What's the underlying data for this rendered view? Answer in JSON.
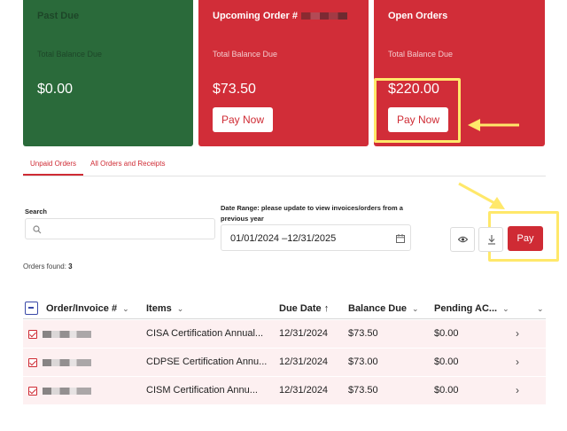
{
  "cards": {
    "past_due": {
      "title": "Past Due",
      "subtitle": "Total Balance Due",
      "amount": "$0.00"
    },
    "upcoming": {
      "title": "Upcoming Order #",
      "subtitle": "Total Balance Due",
      "amount": "$73.50",
      "button": "Pay Now"
    },
    "open": {
      "title": "Open Orders",
      "subtitle": "Total Balance Due",
      "amount": "$220.00",
      "button": "Pay Now"
    }
  },
  "tabs": {
    "unpaid": "Unpaid Orders",
    "all": "All Orders and Receipts"
  },
  "filters": {
    "search_label": "Search",
    "search_value": "",
    "date_label": "Date Range: please update to view invoices/orders from a previous year",
    "date_value": "01/01/2024 –12/31/2025",
    "pay_button": "Pay"
  },
  "orders_found": {
    "label": "Orders found:",
    "count": "3"
  },
  "table": {
    "headers": {
      "order": "Order/Invoice #",
      "items": "Items",
      "due_date": "Due Date ↑",
      "balance": "Balance Due",
      "pending": "Pending AC..."
    },
    "rows": [
      {
        "items": "CISA Certification Annual...",
        "due_date": "12/31/2024",
        "balance": "$73.50",
        "pending": "$0.00"
      },
      {
        "items": "CDPSE Certification Annu...",
        "due_date": "12/31/2024",
        "balance": "$73.00",
        "pending": "$0.00"
      },
      {
        "items": "CISM Certification Annu...",
        "due_date": "12/31/2024",
        "balance": "$73.50",
        "pending": "$0.00"
      }
    ]
  },
  "colors": {
    "accent_red": "#d12d38",
    "past_due_green": "#2a6a3a",
    "highlight_yellow": "#ffe86a",
    "row_tint": "#fdf0f1"
  },
  "icons": [
    "search-icon",
    "calendar-icon",
    "eye-icon",
    "download-icon",
    "chevron-down-icon",
    "chevron-right-icon",
    "arrow-left-icon"
  ]
}
